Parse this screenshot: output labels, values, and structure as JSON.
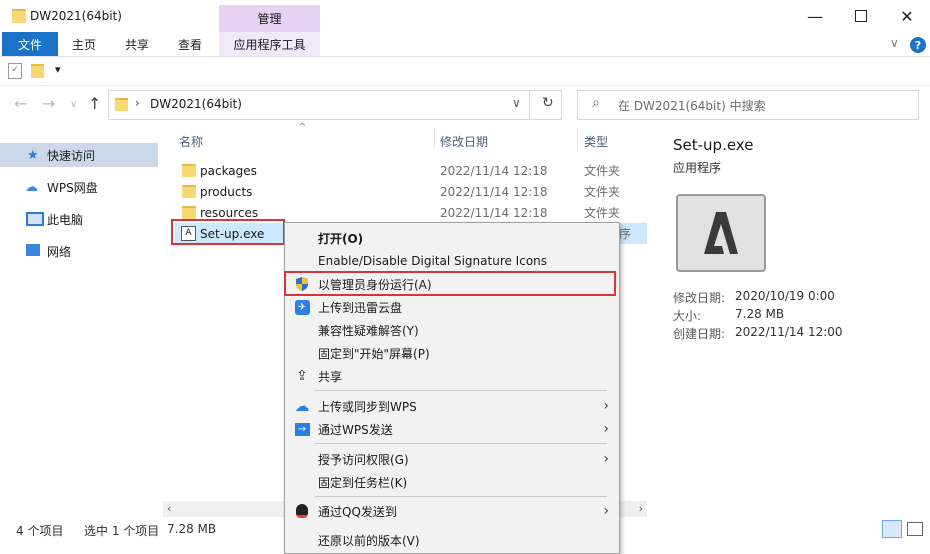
{
  "window": {
    "title": "DW2021(64bit)",
    "contextual_group": "管理",
    "contextual_tab": "应用程序工具"
  },
  "ribbon": {
    "tabs": [
      "文件",
      "主页",
      "共享",
      "查看"
    ]
  },
  "address": {
    "path": "DW2021(64bit)",
    "search_placeholder": "在 DW2021(64bit) 中搜索"
  },
  "nav": {
    "items": [
      {
        "label": "快速访问",
        "icon": "star-icon"
      },
      {
        "label": "WPS网盘",
        "icon": "cloud-icon"
      },
      {
        "label": "此电脑",
        "icon": "computer-icon"
      },
      {
        "label": "网络",
        "icon": "network-icon"
      }
    ]
  },
  "filelist": {
    "columns": [
      "名称",
      "修改日期",
      "类型"
    ],
    "rows": [
      {
        "name": "packages",
        "date": "2022/11/14 12:18",
        "type": "文件夹"
      },
      {
        "name": "products",
        "date": "2022/11/14 12:18",
        "type": "文件夹"
      },
      {
        "name": "resources",
        "date": "2022/11/14 12:18",
        "type": "文件夹"
      },
      {
        "name": "Set-up.exe",
        "date": "",
        "type": "序"
      }
    ]
  },
  "preview": {
    "name": "Set-up.exe",
    "type": "应用程序",
    "meta": [
      {
        "label": "修改日期:",
        "value": "2020/10/19 0:00"
      },
      {
        "label": "大小:",
        "value": "7.28 MB"
      },
      {
        "label": "创建日期:",
        "value": "2022/11/14 12:00"
      }
    ]
  },
  "status": {
    "count": "4 个项目",
    "selected": "选中 1 个项目",
    "size": "7.28 MB"
  },
  "context_menu": {
    "items": [
      {
        "label": "打开(O)",
        "bold": true
      },
      {
        "label": "Enable/Disable Digital Signature Icons"
      },
      {
        "label": "以管理员身份运行(A)",
        "icon": "uac-shield-icon"
      },
      {
        "label": "上传到迅雷云盘",
        "icon": "thunder-icon"
      },
      {
        "label": "兼容性疑难解答(Y)"
      },
      {
        "label": "固定到\"开始\"屏幕(P)"
      },
      {
        "label": "共享",
        "icon": "share-icon"
      },
      {
        "label": "上传或同步到WPS",
        "icon": "wps-cloud-icon"
      },
      {
        "label": "通过WPS发送",
        "icon": "wps-send-icon"
      },
      {
        "label": "授予访问权限(G)"
      },
      {
        "label": "固定到任务栏(K)"
      },
      {
        "label": "通过QQ发送到",
        "icon": "qq-icon"
      },
      {
        "label": "还原以前的版本(V)"
      }
    ]
  },
  "colors": {
    "accent": "#1a73c9",
    "highlight_border": "#d9343a",
    "selection": "#cce8ff",
    "contextual": "#e8d2f5"
  }
}
